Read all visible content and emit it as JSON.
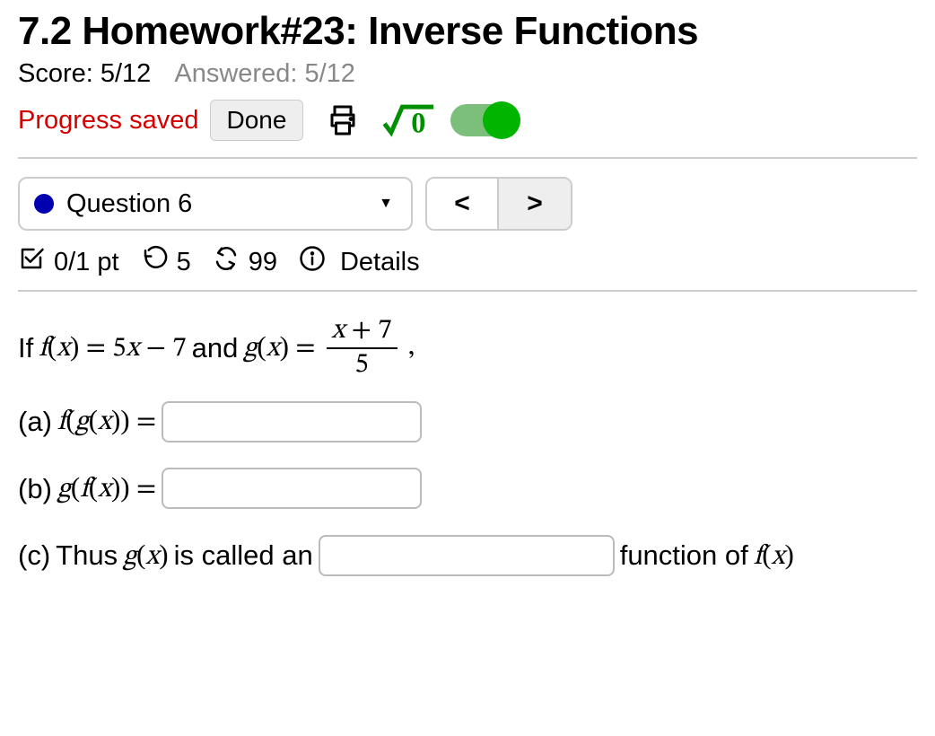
{
  "header": {
    "title": "7.2 Homework#23: Inverse Functions",
    "score_label": "Score: 5/12",
    "answered_label": "Answered: 5/12",
    "progress_label": "Progress saved",
    "done_label": "Done"
  },
  "nav": {
    "question_label": "Question 6",
    "prev": "<",
    "next": ">"
  },
  "qinfo": {
    "points": "0/1 pt",
    "attempts": "5",
    "retries": "99",
    "details": "Details"
  },
  "question": {
    "intro_prefix": "If ",
    "f_def_coeff": "5",
    "f_def_const": "7",
    "and_word": " and ",
    "g_num_const": "7",
    "g_den": "5",
    "comma": ",",
    "part_a_label": "(a)",
    "part_b_label": "(b)",
    "part_c_label": "(c)",
    "part_c_prefix": "Thus ",
    "part_c_mid": " is called an ",
    "part_c_suffix": " function of "
  }
}
